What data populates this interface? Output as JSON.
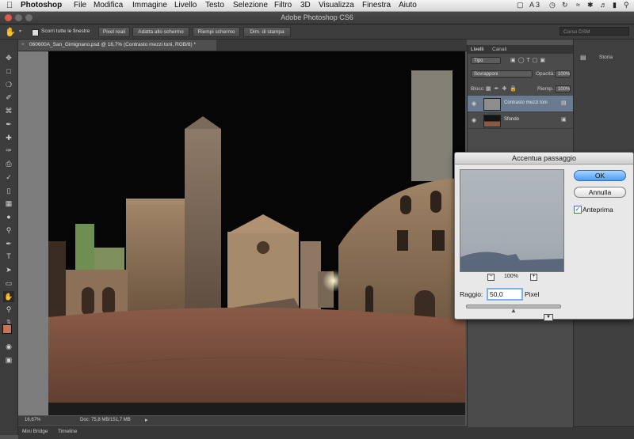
{
  "menubar": {
    "app_name": "Photoshop",
    "items": [
      "File",
      "Modifica",
      "Immagine",
      "Livello",
      "Testo",
      "Selezione",
      "Filtro",
      "3D",
      "Visualizza",
      "Finestra",
      "Aiuto"
    ],
    "tray": [
      "A 3"
    ]
  },
  "window": {
    "title": "Adobe Photoshop CS6"
  },
  "options_bar": {
    "checkbox_label": "Scorri tutte le finestre",
    "buttons": [
      "Pixel reali",
      "Adatta allo schermo",
      "Riempi schermo",
      "Dim. di stampa"
    ],
    "workspace": "Corso DSM"
  },
  "document": {
    "tab_title": "060600A_San_Gimignano.psd @ 16,7% (Contrasto mezzi toni, RGB/8) *"
  },
  "status": {
    "zoom": "16,67%",
    "doc_info": "Doc: 75,8 MB/151,7 MB"
  },
  "bottom_tabs": [
    "Mini Bridge",
    "Timeline"
  ],
  "layers_panel": {
    "tabs": [
      "Livelli",
      "Canali"
    ],
    "filter_label": "Tipo",
    "blend_mode": "Sovrapponi",
    "opacity_label": "Opacità:",
    "opacity_value": "100%",
    "lock_label": "Blocc:",
    "fill_label": "Riemp.:",
    "fill_value": "100%",
    "layers": [
      {
        "name": "Contrasto mezzi toni",
        "selected": true
      },
      {
        "name": "Sfondo",
        "selected": false
      }
    ]
  },
  "right_panel": {
    "title": "Storia"
  },
  "dialog": {
    "title": "Accentua passaggio",
    "ok_label": "OK",
    "cancel_label": "Annulla",
    "preview_label": "Anteprima",
    "preview_checked": true,
    "zoom_value": "100%",
    "radius_label": "Raggio:",
    "radius_value": "50,0",
    "radius_unit": "Pixel",
    "slider_fraction": 0.5
  }
}
